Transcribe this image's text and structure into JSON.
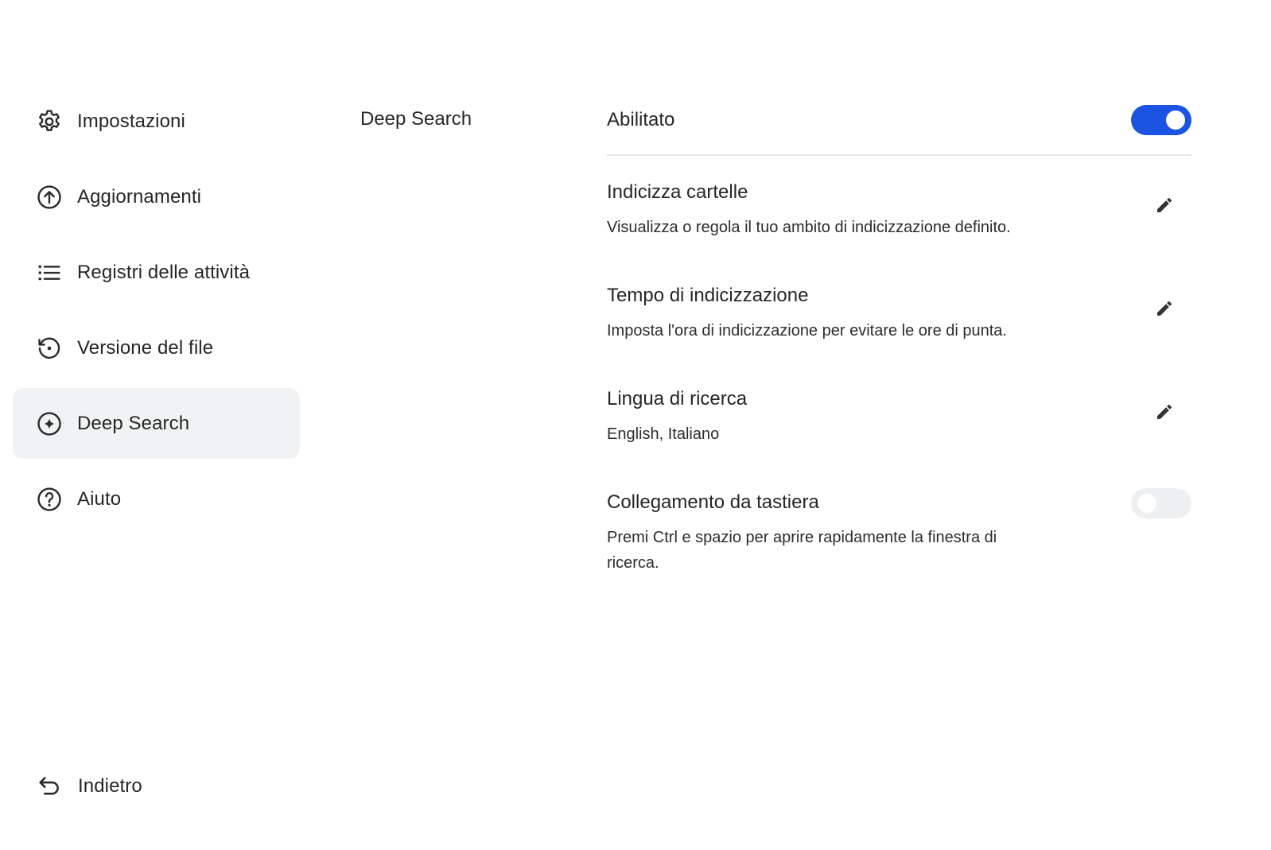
{
  "sidebar": {
    "items": [
      {
        "label": "Impostazioni",
        "icon": "gear-icon",
        "active": false
      },
      {
        "label": "Aggiornamenti",
        "icon": "upload-circle-icon",
        "active": false
      },
      {
        "label": "Registri delle attività",
        "icon": "list-icon",
        "active": false
      },
      {
        "label": "Versione del file",
        "icon": "history-icon",
        "active": false
      },
      {
        "label": "Deep Search",
        "icon": "sparkle-circle-icon",
        "active": true
      },
      {
        "label": "Aiuto",
        "icon": "help-circle-icon",
        "active": false
      }
    ],
    "back_label": "Indietro"
  },
  "section": {
    "title": "Deep Search"
  },
  "settings": {
    "enabled": {
      "label": "Abilitato",
      "on": true
    },
    "index_folders": {
      "title": "Indicizza cartelle",
      "description": "Visualizza o regola il tuo ambito di indicizzazione definito."
    },
    "index_time": {
      "title": "Tempo di indicizzazione",
      "description": "Imposta l'ora di indicizzazione per evitare le ore di punta."
    },
    "search_language": {
      "title": "Lingua di ricerca",
      "description": "English, Italiano"
    },
    "keyboard_shortcut": {
      "title": "Collegamento da tastiera",
      "description": "Premi Ctrl e spazio per aprire rapidamente la finestra di ricerca.",
      "on": false
    }
  },
  "colors": {
    "accent": "#1b53e3",
    "active_bg": "#f1f2f3",
    "divider": "#e6e7e9",
    "toggle_off": "#eeeff1"
  }
}
